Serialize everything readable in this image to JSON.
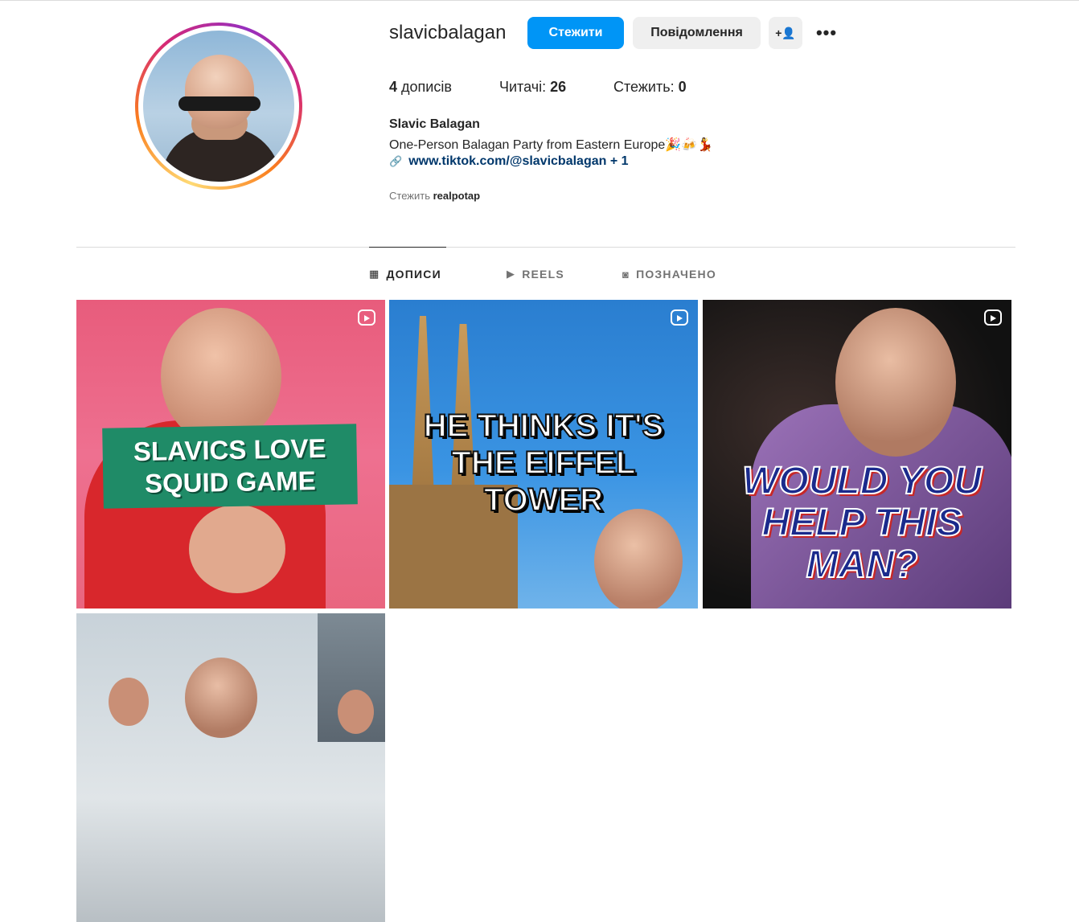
{
  "profile": {
    "username": "slavicbalagan",
    "full_name": "Slavic Balagan",
    "bio": "One-Person Balagan Party from Eastern Europe🎉🍻💃",
    "link": "www.tiktok.com/@slavicbalagan + 1",
    "followed_by_label": "Стежить",
    "followed_by_user": "realpotap"
  },
  "actions": {
    "follow_label": "Стежити",
    "message_label": "Повідомлення",
    "add_user_icon": "+👤",
    "more_icon": "•••"
  },
  "stats": {
    "posts_count": "4",
    "posts_label": "дописів",
    "followers_label": "Читачі:",
    "followers_count": "26",
    "following_label": "Стежить:",
    "following_count": "0"
  },
  "tabs": [
    {
      "label": "ДОПИСИ",
      "icon": "grid-icon",
      "glyph": "▦",
      "active": true
    },
    {
      "label": "REELS",
      "icon": "reels-icon",
      "glyph": "▶",
      "active": false
    },
    {
      "label": "ПОЗНАЧЕНО",
      "icon": "tagged-icon",
      "glyph": "◙",
      "active": false
    }
  ],
  "posts": [
    {
      "caption_line1": "SLAVICS LOVE",
      "caption_line2": "SQUID GAME",
      "type": "reel"
    },
    {
      "caption_line1": "HE THINKS IT'S",
      "caption_line2": "THE EIFFEL TOWER",
      "type": "reel"
    },
    {
      "caption_line1": "WOULD YOU",
      "caption_line2": "HELP THIS",
      "caption_line3": "MAN?",
      "type": "reel"
    },
    {
      "type": "post"
    }
  ],
  "colors": {
    "accent": "#0095f6",
    "link": "#00376b",
    "secondary_text": "#737373"
  }
}
